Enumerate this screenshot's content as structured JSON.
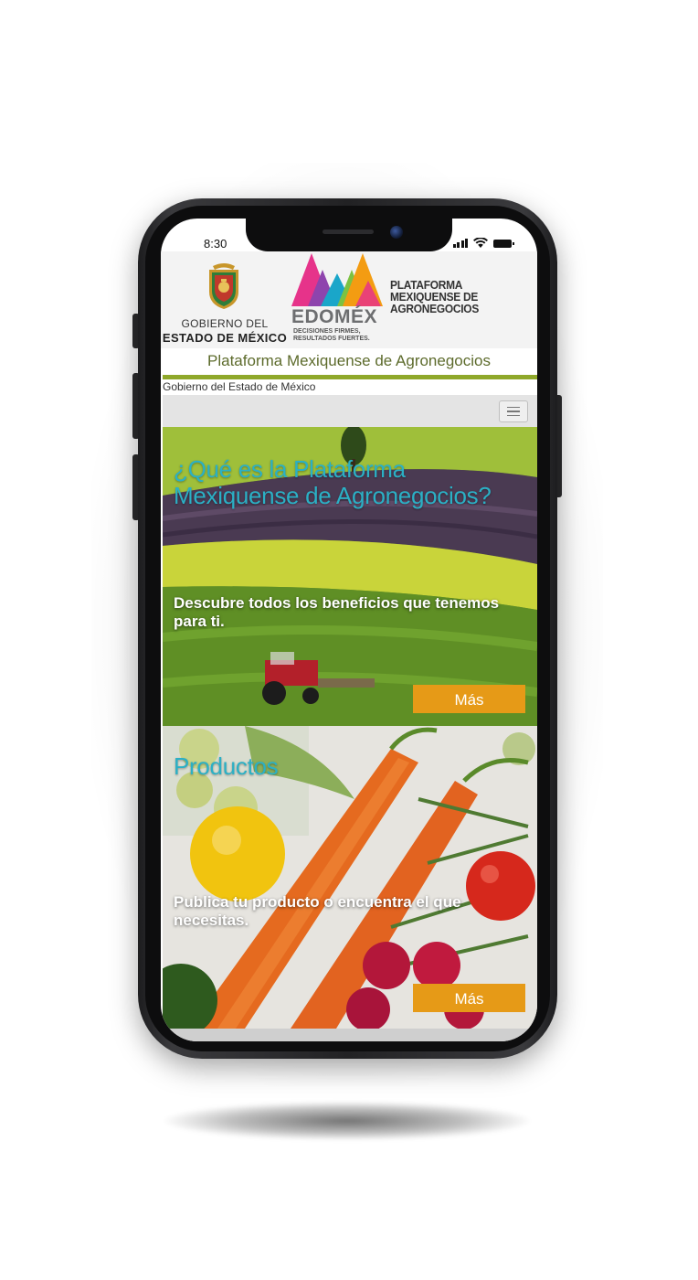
{
  "status_bar": {
    "time": "8:30"
  },
  "header": {
    "gobierno_line1": "GOBIERNO DEL",
    "gobierno_line2": "ESTADO DE MÉXICO",
    "edomex_word": "EDOMÉX",
    "slogan_line1": "DECISIONES FIRMES,",
    "slogan_line2": "RESULTADOS FUERTES.",
    "plataforma_logo_line1": "PLATAFORMA",
    "plataforma_logo_line2": "MEXIQUENSE DE",
    "plataforma_logo_line3": "AGRONEGOCIOS"
  },
  "site": {
    "title": "Plataforma Mexiquense de Agronegocios",
    "breadcrumb": "Gobierno del Estado de México"
  },
  "cards": [
    {
      "title": "¿Qué es la Plataforma Mexiquense de Agronegocios?",
      "text": "Descubre todos los beneficios que tenemos para ti.",
      "button": "Más"
    },
    {
      "title": "Productos",
      "text": "Publica tu producto o encuentra el que necesitas.",
      "button": "Más"
    }
  ],
  "colors": {
    "accent_green": "#8fa82a",
    "title_cyan": "#2bb0c5",
    "button_orange": "#e69a17",
    "site_title_text": "#5d6b2c"
  }
}
